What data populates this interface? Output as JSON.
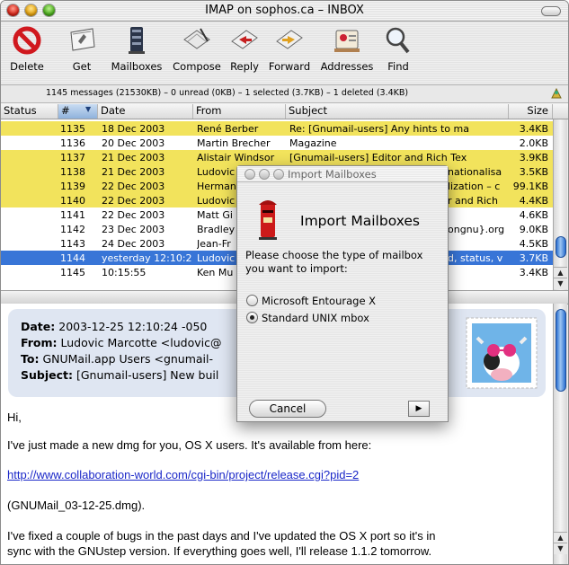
{
  "window": {
    "title": "IMAP on sophos.ca – INBOX"
  },
  "toolbar": {
    "items": [
      {
        "label": "Delete",
        "icon": "delete-icon"
      },
      {
        "label": "Get",
        "icon": "get-mail-icon"
      },
      {
        "label": "Mailboxes",
        "icon": "mailboxes-icon"
      },
      {
        "label": "Compose",
        "icon": "compose-icon"
      },
      {
        "label": "Reply",
        "icon": "reply-icon"
      },
      {
        "label": "Forward",
        "icon": "forward-icon"
      },
      {
        "label": "Addresses",
        "icon": "addresses-icon"
      },
      {
        "label": "Find",
        "icon": "find-icon"
      }
    ]
  },
  "status_line": "1145 messages (21530KB) – 0 unread (0KB) – 1 selected (3.7KB) – 1 deleted (3.4KB)",
  "table": {
    "columns": {
      "status": "Status",
      "number": "#",
      "date": "Date",
      "from": "From",
      "subject": "Subject",
      "size": "Size"
    },
    "rows": [
      {
        "flags": "M",
        "number": "1135",
        "date": "18 Dec 2003",
        "from": "René Berber",
        "subject": "Re: [Gnumail-users] Any hints to ma",
        "size": "3.4KB",
        "highlight": "yellow"
      },
      {
        "flags": "M A",
        "number": "1136",
        "date": "20 Dec 2003",
        "from": "Martin Brecher",
        "subject": "Magazine",
        "size": "2.0KB",
        "highlight": "none"
      },
      {
        "flags": "M A",
        "number": "1137",
        "date": "21 Dec 2003",
        "from": "Alistair Windsor",
        "subject": "[Gnumail-users] Editor and Rich Tex",
        "size": "3.9KB",
        "highlight": "yellow"
      },
      {
        "flags": "M",
        "number": "1138",
        "date": "21 Dec 2003",
        "from": "Ludovic",
        "subject": "nationalisa",
        "size": "3.5KB",
        "highlight": "yellow"
      },
      {
        "flags": "M A",
        "number": "1139",
        "date": "22 Dec 2003",
        "from": "Herman",
        "subject": "lization – c",
        "size": "99.1KB",
        "highlight": "yellow"
      },
      {
        "flags": "M",
        "number": "1140",
        "date": "22 Dec 2003",
        "from": "Ludovic",
        "subject": "r and Rich",
        "size": "4.4KB",
        "highlight": "yellow"
      },
      {
        "flags": "M A",
        "number": "1141",
        "date": "22 Dec 2003",
        "from": "Matt Gi",
        "subject": "",
        "size": "4.6KB",
        "highlight": "none"
      },
      {
        "flags": "",
        "number": "1142",
        "date": "23 Dec 2003",
        "from": "Bradley",
        "subject": "ongnu}.org",
        "size": "9.0KB",
        "highlight": "none"
      },
      {
        "flags": "M",
        "number": "1143",
        "date": "24 Dec 2003",
        "from": "Jean-Fr",
        "subject": "",
        "size": "4.5KB",
        "highlight": "none"
      },
      {
        "flags": "M",
        "number": "1144",
        "date": "yesterday 12:10:2",
        "from": "Ludovic",
        "subject": "d, status, v",
        "size": "3.7KB",
        "highlight": "selected"
      },
      {
        "flags": "M",
        "number": "1145",
        "date": "10:15:55",
        "from": "Ken Mu",
        "subject": "",
        "size": "3.4KB",
        "highlight": "none"
      }
    ]
  },
  "preview": {
    "date_label": "Date:",
    "date_value": "2003-12-25 12:10:24 -050",
    "from_label": "From:",
    "from_value": "Ludovic Marcotte <ludovic@",
    "to_label": "To:",
    "to_value": "GNUMail.app Users <gnumail-",
    "subject_label": "Subject:",
    "subject_value": "[Gnumail-users] New buil",
    "body": {
      "greeting": "Hi,",
      "p1": "I've just made a new dmg for you, OS X users. It's available from here:",
      "link": "http://www.collaboration-world.com/cgi-bin/project/release.cgi?pid=2",
      "p2": "(GNUMail_03-12-25.dmg).",
      "p3a": "I've fixed a couple of bugs in the past days and I've updated the OS X port so it's in",
      "p3b": "sync with the GNUstep version. If everything goes well, I'll release 1.1.2 tomorrow."
    }
  },
  "dialog": {
    "window_title": "Import Mailboxes",
    "heading": "Import Mailboxes",
    "prompt": "Please choose the type of mailbox you want to import:",
    "options": [
      {
        "label": "Microsoft Entourage X",
        "selected": false
      },
      {
        "label": "Standard UNIX mbox",
        "selected": true
      }
    ],
    "cancel": "Cancel",
    "next_glyph": "▶"
  },
  "colors": {
    "highlight_yellow": "#f2e35c",
    "selection_blue": "#3875d7",
    "link_blue": "#1a27c8",
    "header_box": "#dfe6f2"
  }
}
